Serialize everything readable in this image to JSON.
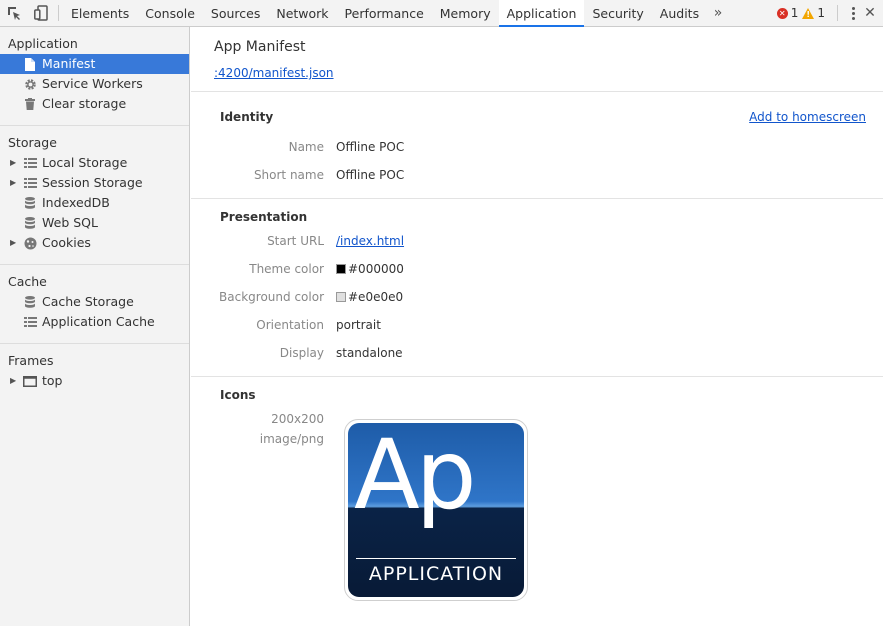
{
  "toolbar": {
    "tabs": [
      "Elements",
      "Console",
      "Sources",
      "Network",
      "Performance",
      "Memory",
      "Application",
      "Security",
      "Audits"
    ],
    "active_tab": "Application",
    "more_label": "»",
    "error_count": "1",
    "warning_count": "1"
  },
  "sidebar": {
    "sections": [
      {
        "title": "Application",
        "items": [
          {
            "label": "Manifest",
            "icon": "document-icon",
            "selected": true
          },
          {
            "label": "Service Workers",
            "icon": "gear-icon"
          },
          {
            "label": "Clear storage",
            "icon": "trash-icon"
          }
        ]
      },
      {
        "title": "Storage",
        "items": [
          {
            "label": "Local Storage",
            "icon": "grid-icon",
            "expandable": true
          },
          {
            "label": "Session Storage",
            "icon": "grid-icon",
            "expandable": true
          },
          {
            "label": "IndexedDB",
            "icon": "database-icon"
          },
          {
            "label": "Web SQL",
            "icon": "database-icon"
          },
          {
            "label": "Cookies",
            "icon": "cookie-icon",
            "expandable": true
          }
        ]
      },
      {
        "title": "Cache",
        "items": [
          {
            "label": "Cache Storage",
            "icon": "database-icon"
          },
          {
            "label": "Application Cache",
            "icon": "grid-icon"
          }
        ]
      },
      {
        "title": "Frames",
        "items": [
          {
            "label": "top",
            "icon": "frame-icon",
            "expandable": true
          }
        ]
      }
    ]
  },
  "main": {
    "title": "App Manifest",
    "manifest_link": ":4200/manifest.json",
    "identity": {
      "heading": "Identity",
      "add_to_homescreen": "Add to homescreen",
      "name_label": "Name",
      "name_value": "Offline POC",
      "short_name_label": "Short name",
      "short_name_value": "Offline POC"
    },
    "presentation": {
      "heading": "Presentation",
      "start_url_label": "Start URL",
      "start_url_value": "/index.html",
      "theme_color_label": "Theme color",
      "theme_color_value": "#000000",
      "background_color_label": "Background color",
      "background_color_value": "#e0e0e0",
      "orientation_label": "Orientation",
      "orientation_value": "portrait",
      "display_label": "Display",
      "display_value": "standalone"
    },
    "icons": {
      "heading": "Icons",
      "size": "200x200",
      "type": "image/png",
      "icon_big_text": "Ap",
      "icon_sub_text": "APPLICATION"
    }
  },
  "colors": {
    "accent": "#1a73e8",
    "selected_bg": "#3879d9",
    "link": "#1155cc"
  }
}
